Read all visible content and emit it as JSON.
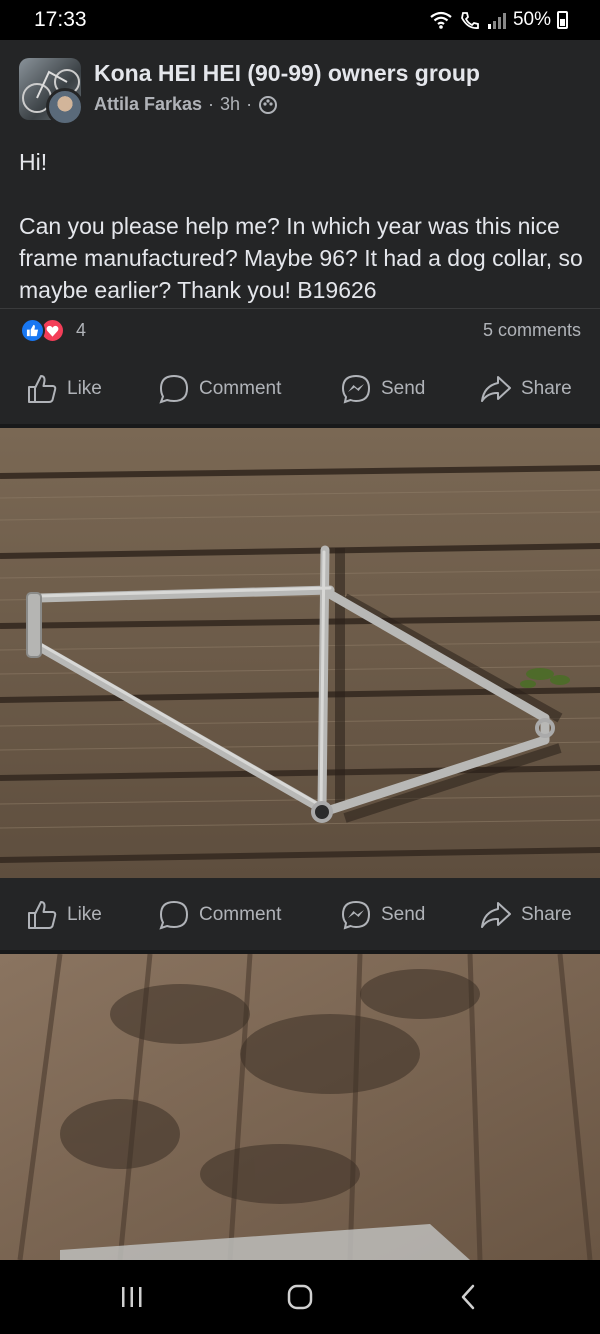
{
  "status": {
    "time": "17:33",
    "battery": "50%"
  },
  "post": {
    "group_name": "Kona HEI HEI (90-99) owners group",
    "author": "Attila Farkas",
    "time_ago": "3h",
    "separator": "·",
    "text": "Hi!\n\nCan you please help me? In which year was this nice frame manufactured? Maybe 96? It had a dog collar, so maybe earlier? Thank you! B19626",
    "reaction_count": "4",
    "comments": "5 comments"
  },
  "actions": {
    "like": "Like",
    "comment": "Comment",
    "send": "Send",
    "share": "Share"
  },
  "icons": {
    "group_avatar": "bike-photo-avatar",
    "user_avatar": "user-avatar",
    "audience": "group-members-icon",
    "like_reaction": "thumbs-up-icon",
    "love_reaction": "heart-icon",
    "nav_recents": "recents-icon",
    "nav_home": "home-icon",
    "nav_back": "back-icon"
  },
  "colors": {
    "background": "#242526",
    "text_primary": "#e4e6eb",
    "text_secondary": "#b0b3b8",
    "like_blue": "#1877f2",
    "love_red": "#f33e58"
  }
}
